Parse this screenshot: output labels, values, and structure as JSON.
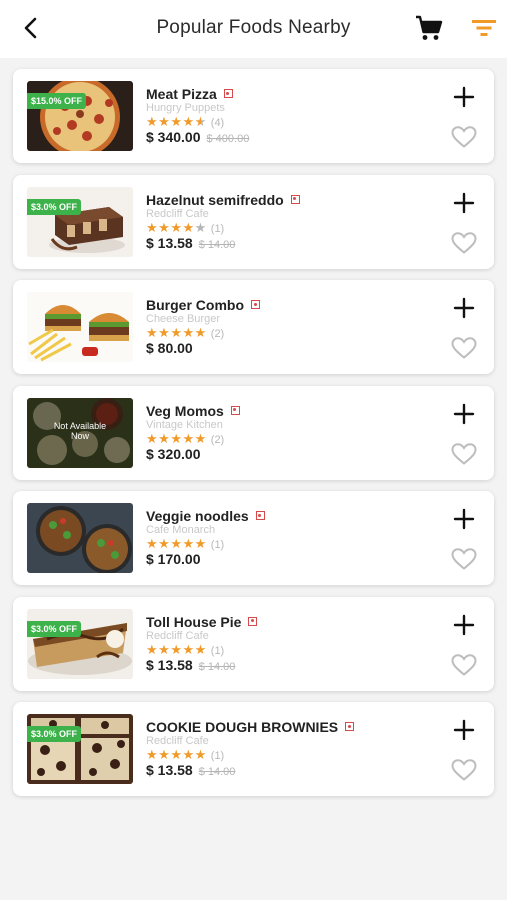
{
  "header": {
    "title": "Popular Foods Nearby"
  },
  "colors": {
    "accent": "#f09a2a",
    "badge": "#3db24a",
    "veg_mark": "#d84a4a"
  },
  "items": [
    {
      "name": "Meat Pizza",
      "restaurant": "Hungry Puppets",
      "rating": 4.5,
      "reviews": "(4)",
      "price": "$ 340.00",
      "old_price": "$ 400.00",
      "discount": "$15.0% OFF",
      "available_text": "",
      "image": "pizza"
    },
    {
      "name": "Hazelnut semifreddo",
      "restaurant": "Redcliff Cafe",
      "rating": 4,
      "reviews": "(1)",
      "price": "$ 13.58",
      "old_price": "$ 14.00",
      "discount": "$3.0% OFF",
      "available_text": "",
      "image": "dessert"
    },
    {
      "name": "Burger Combo",
      "restaurant": "Cheese Burger",
      "rating": 5,
      "reviews": "(2)",
      "price": "$ 80.00",
      "old_price": "",
      "discount": "",
      "available_text": "",
      "image": "burger"
    },
    {
      "name": "Veg Momos",
      "restaurant": "Vintage Kitchen",
      "rating": 5,
      "reviews": "(2)",
      "price": "$ 320.00",
      "old_price": "",
      "discount": "",
      "available_text": "Not Available Now",
      "image": "momos"
    },
    {
      "name": "Veggie noodles",
      "restaurant": "Cafe Monarch",
      "rating": 5,
      "reviews": "(1)",
      "price": "$ 170.00",
      "old_price": "",
      "discount": "",
      "available_text": "",
      "image": "noodles"
    },
    {
      "name": "Toll House Pie",
      "restaurant": "Redcliff Cafe",
      "rating": 5,
      "reviews": "(1)",
      "price": "$ 13.58",
      "old_price": "$ 14.00",
      "discount": "$3.0% OFF",
      "available_text": "",
      "image": "pie"
    },
    {
      "name": "COOKIE DOUGH BROWNIES",
      "restaurant": "Redcliff Cafe",
      "rating": 5,
      "reviews": "(1)",
      "price": "$ 13.58",
      "old_price": "$ 14.00",
      "discount": "$3.0% OFF",
      "available_text": "",
      "image": "brownie"
    }
  ]
}
